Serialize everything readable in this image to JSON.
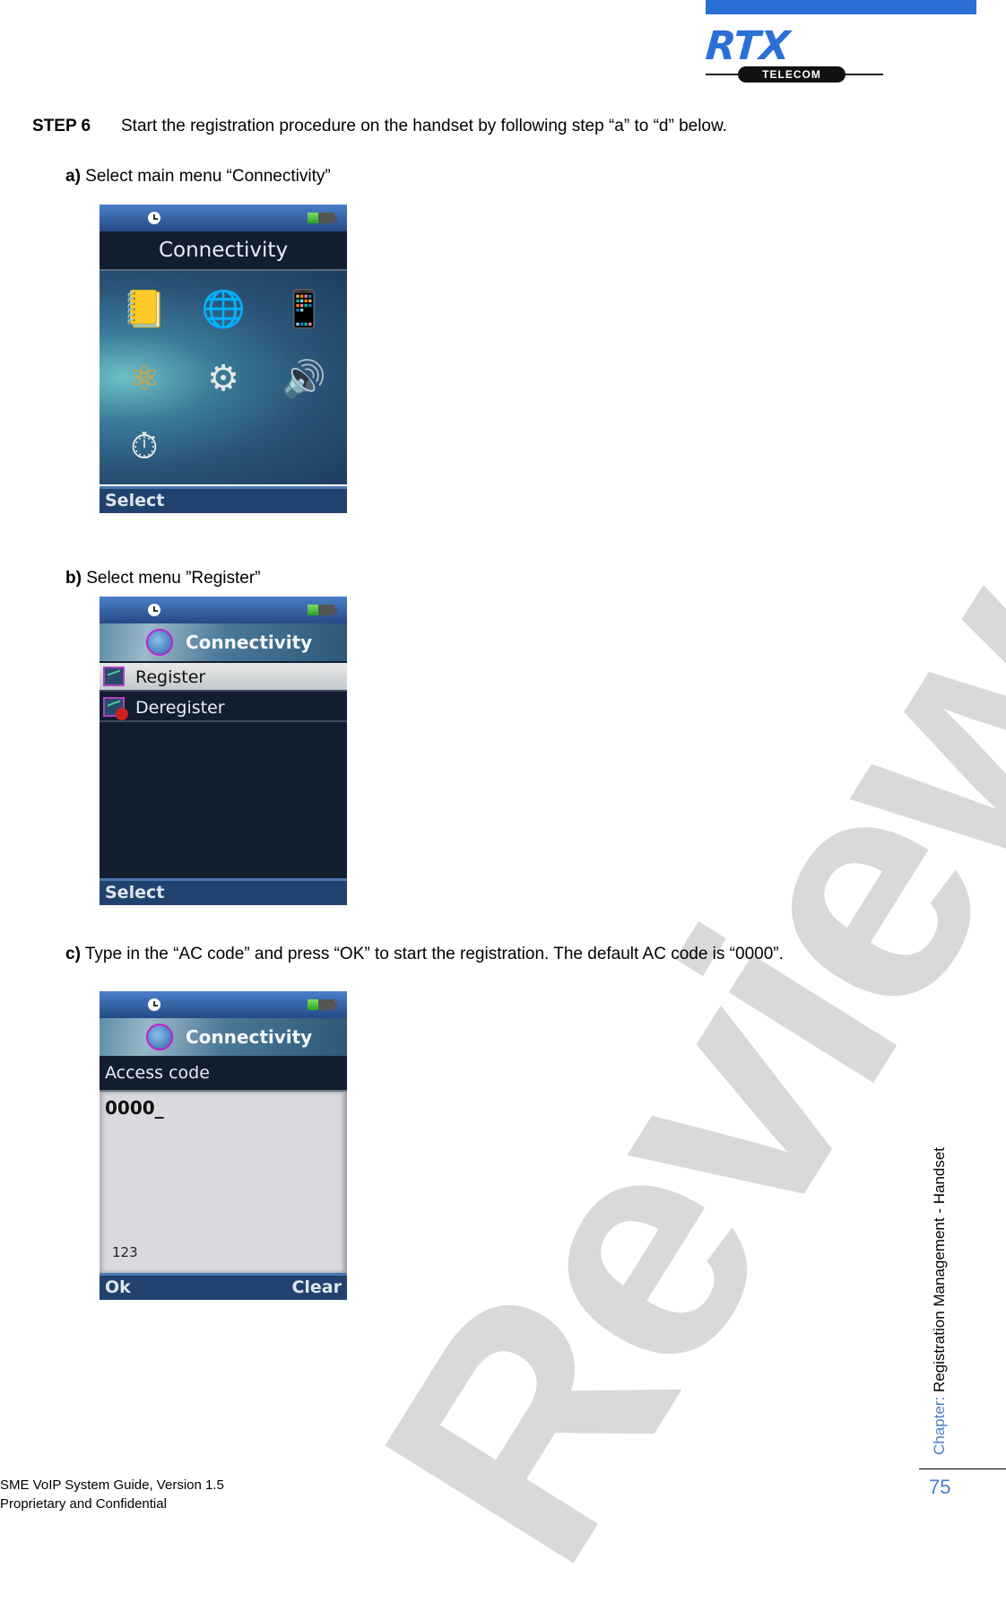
{
  "header": {
    "logo_text": "RTX",
    "logo_subtext": "TELECOM",
    "brand_color": "#2a6fd6"
  },
  "step": {
    "label": "STEP 6",
    "text": "Start the registration procedure on the handset by following step “a” to “d” below."
  },
  "substeps": [
    {
      "marker": "a)",
      "text": " Select main menu “Connectivity”"
    },
    {
      "marker": "b)",
      "text": "  Select menu ”Register”"
    },
    {
      "marker": "c)",
      "text": "  Type in the “AC code” and press “OK” to start the registration. The default AC code is “0000”."
    }
  ],
  "screens": {
    "menu": {
      "title": "Connectivity",
      "battery_level": 0.4,
      "icons": [
        {
          "name": "phonebook-icon",
          "glyph": "📒"
        },
        {
          "name": "globe-connectivity-icon",
          "glyph": "🌐"
        },
        {
          "name": "handset-icon",
          "glyph": "📱"
        },
        {
          "name": "network-molecule-icon",
          "glyph": "⚛"
        },
        {
          "name": "settings-gear-icon",
          "glyph": "⚙"
        },
        {
          "name": "speaker-icon",
          "glyph": "🔊"
        },
        {
          "name": "calculator-stopwatch-icon",
          "glyph": "⏱"
        }
      ],
      "softkey_left": "Select"
    },
    "register": {
      "title": "Connectivity",
      "items": [
        {
          "label": "Register",
          "selected": true
        },
        {
          "label": "Deregister",
          "selected": false
        }
      ],
      "softkey_left": "Select"
    },
    "access_code": {
      "title": "Connectivity",
      "field_label": "Access code",
      "value": "0000_",
      "input_mode": "123",
      "softkey_left": "Ok",
      "softkey_right": "Clear"
    }
  },
  "watermark": "Reviewed",
  "side": {
    "chapter_label": "Chapter: ",
    "chapter_title": "Registration Management - Handset",
    "page_number": "75"
  },
  "footer": {
    "line1": "SME VoIP System Guide, Version 1.5",
    "line2": "Proprietary and Confidential"
  }
}
